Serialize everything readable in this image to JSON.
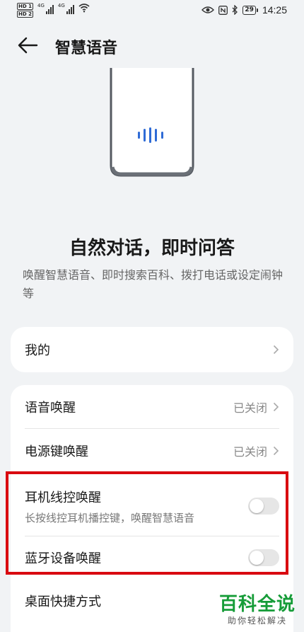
{
  "status_bar": {
    "sim1": "HD 1",
    "sim2": "HD 2",
    "network1": "4G",
    "network2": "4G",
    "battery": "29",
    "time": "14:25"
  },
  "header": {
    "title": "智慧语音",
    "back_icon": "back-arrow-icon"
  },
  "intro": {
    "headline": "自然对话，即时问答",
    "description": "唤醒智慧语音、即时搜索百科、拨打电话或设定闹钟等"
  },
  "card_mine": {
    "label": "我的"
  },
  "card_wake": {
    "items": [
      {
        "label": "语音唤醒",
        "value": "已关闭",
        "type": "link"
      },
      {
        "label": "电源键唤醒",
        "value": "已关闭",
        "type": "link"
      },
      {
        "label": "耳机线控唤醒",
        "sub": "长按线控耳机播控键，唤醒智慧语音",
        "type": "toggle",
        "on": false
      },
      {
        "label": "蓝牙设备唤醒",
        "type": "toggle",
        "on": false
      },
      {
        "label": "桌面快捷方式",
        "type": "link"
      }
    ]
  },
  "watermark": {
    "main": "百科全说",
    "sub": "助你轻松解决"
  },
  "colors": {
    "accent": "#2f6bd6",
    "highlight": "#d90a10",
    "watermark": "#169c38"
  }
}
